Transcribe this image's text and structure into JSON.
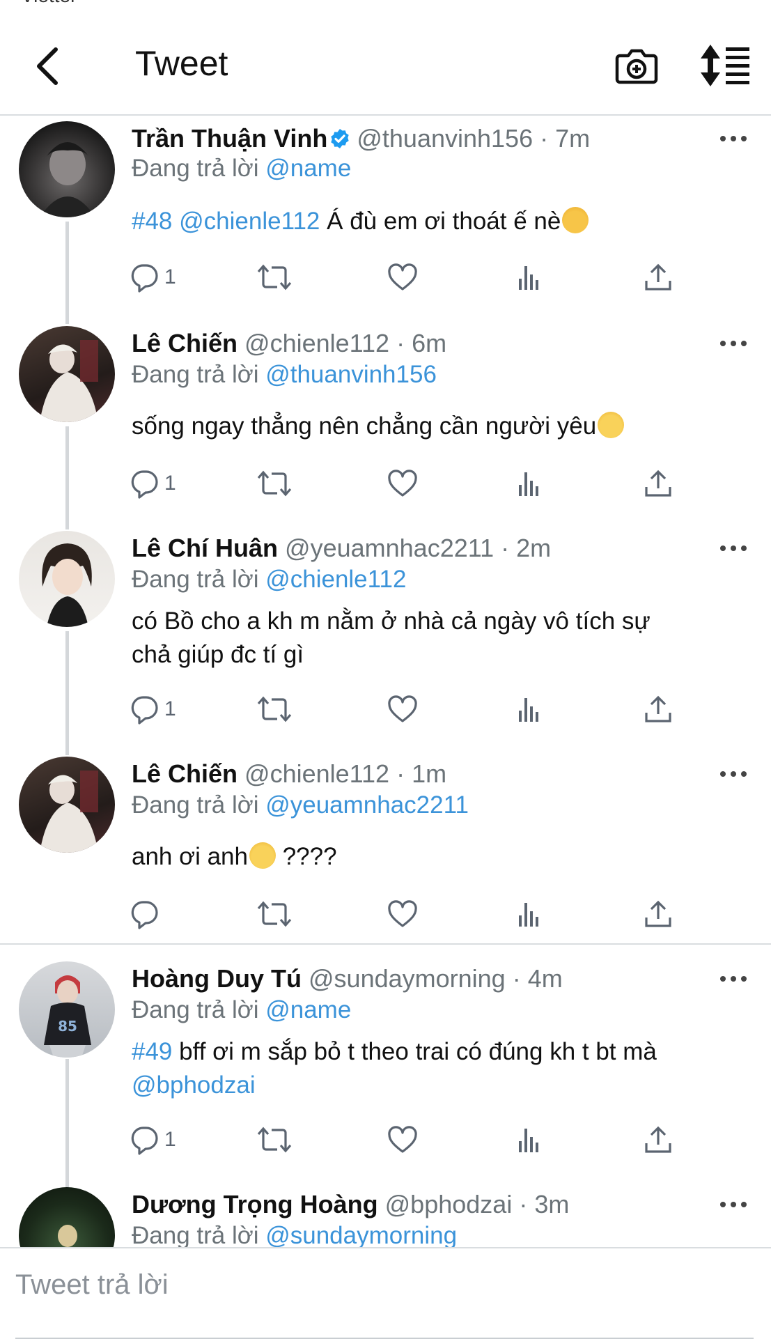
{
  "status_bar": {
    "left": "Viettel",
    "right": ""
  },
  "header": {
    "title": "Tweet"
  },
  "replying_prefix": "Đang trả lời",
  "tweets": [
    {
      "name": "Trần Thuận Vinh",
      "verified": true,
      "handle": "@thuanvinh156",
      "time": "7m",
      "reply_to": "@name",
      "hashtag": "#48",
      "mention": "@chienle112",
      "text": "Á đù em ơi thoát ế nè",
      "emoji": "exploding-head",
      "reply_count": "1"
    },
    {
      "name": "Lê Chiến",
      "handle": "@chienle112",
      "time": "6m",
      "reply_to": "@thuanvinh156",
      "text": "sống ngay thẳng nên chẳng cần người yêu",
      "emoji": "relieved-face",
      "reply_count": "1"
    },
    {
      "name": "Lê Chí Huân",
      "handle": "@yeuamnhac2211",
      "time": "2m",
      "reply_to": "@chienle112",
      "text_line1": "có Bồ cho a kh m nằm ở nhà cả ngày vô tích sự",
      "text_line2": "chả giúp đc tí gì",
      "reply_count": "1"
    },
    {
      "name": "Lê Chiến",
      "handle": "@chienle112",
      "time": "1m",
      "reply_to": "@yeuamnhac2211",
      "text_before": "anh ơi anh",
      "emoji": "crying-face",
      "text_after": " ????",
      "reply_count": ""
    },
    {
      "name": "Hoàng Duy Tú",
      "handle": "@sundaymorning",
      "time": "4m",
      "reply_to": "@name",
      "hashtag": "#49",
      "text": "bff ơi m sắp bỏ t theo trai có đúng kh t bt mà",
      "mention": "@bphodzai",
      "reply_count": "1"
    },
    {
      "name": "Dương Trọng Hoàng",
      "handle": "@bphodzai",
      "time": "3m",
      "reply_to": "@sundaymorning"
    }
  ],
  "time_separator": "·",
  "composer": {
    "placeholder": "Tweet trả lời"
  },
  "colors": {
    "link": "#3b93d9",
    "text": "#0f1419",
    "muted": "#6b7378",
    "verified": "#1d9bf0"
  }
}
